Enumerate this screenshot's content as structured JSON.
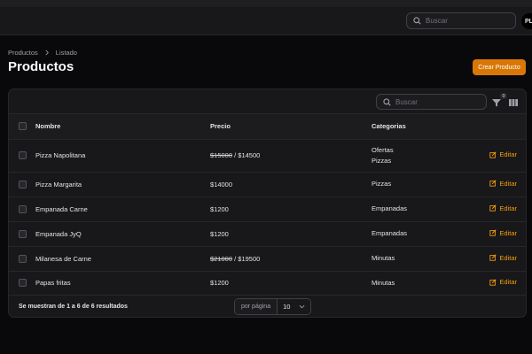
{
  "topbar": {
    "search_placeholder": "Buscar",
    "avatar_initials": "PL"
  },
  "breadcrumb": [
    "Productos",
    "Listado"
  ],
  "page": {
    "title": "Productos",
    "create_button": "Crear Producto"
  },
  "table": {
    "search_placeholder": "Buscar",
    "filter_count": "0",
    "columns": [
      "Nombre",
      "Precio",
      "Categorias"
    ],
    "rows": [
      {
        "name": "Pizza Napolitana",
        "old_price": "$15000",
        "price_sep": " / ",
        "price": "$14500",
        "categories": [
          "Ofertas",
          "Pizzas"
        ],
        "action": "Editar"
      },
      {
        "name": "Pizza Margarita",
        "old_price": "",
        "price_sep": "",
        "price": "$14000",
        "categories": [
          "Pizzas"
        ],
        "action": "Editar"
      },
      {
        "name": "Empanada Carne",
        "old_price": "",
        "price_sep": "",
        "price": "$1200",
        "categories": [
          "Empanadas"
        ],
        "action": "Editar"
      },
      {
        "name": "Empanada JyQ",
        "old_price": "",
        "price_sep": "",
        "price": "$1200",
        "categories": [
          "Empanadas"
        ],
        "action": "Editar"
      },
      {
        "name": "Milanesa de Carne",
        "old_price": "$21000",
        "price_sep": " / ",
        "price": "$19500",
        "categories": [
          "Minutas"
        ],
        "action": "Editar"
      },
      {
        "name": "Papas fritas",
        "old_price": "",
        "price_sep": "",
        "price": "$1200",
        "categories": [
          "Minutas"
        ],
        "action": "Editar"
      }
    ]
  },
  "footer": {
    "results_text": "Se muestran de 1 a 6 de 6 resultados",
    "per_page_label": "por página",
    "per_page_value": "10"
  },
  "colors": {
    "accent": "#d97706",
    "edit_link": "#f59e0b",
    "background": "#09090b",
    "card": "#18181b"
  }
}
